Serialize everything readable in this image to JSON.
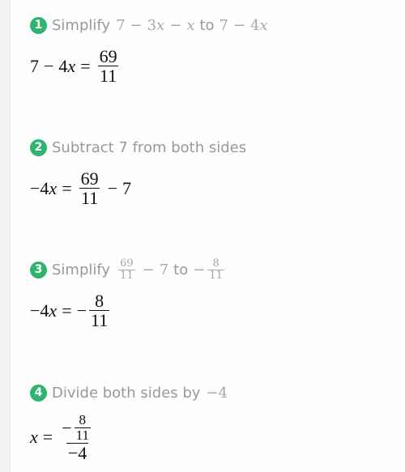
{
  "colors": {
    "badge": "#2fb46e",
    "step_text": "#999999",
    "math": "#111111"
  },
  "steps": [
    {
      "number": "1",
      "action": "Simplify",
      "from": {
        "parts": [
          "7",
          "−",
          "3",
          "x",
          "−",
          "x"
        ]
      },
      "connector": "to",
      "to": {
        "parts": [
          "7",
          "−",
          "4",
          "x"
        ]
      },
      "equation": {
        "lhs": [
          "7",
          "−",
          "4",
          "x"
        ],
        "eq": "=",
        "rhs_num": "69",
        "rhs_den": "11"
      }
    },
    {
      "number": "2",
      "action": "Subtract 7 from both sides",
      "equation": {
        "lhs": [
          "−",
          "4",
          "x"
        ],
        "eq": "=",
        "rhs_num": "69",
        "rhs_den": "11",
        "rhs_tail": [
          "−",
          "7"
        ]
      }
    },
    {
      "number": "3",
      "action": "Simplify",
      "from": {
        "frac_num": "69",
        "frac_den": "11",
        "tail": [
          "−",
          "7"
        ]
      },
      "connector": "to",
      "to": {
        "sign": "−",
        "frac_num": "8",
        "frac_den": "11"
      },
      "equation": {
        "lhs": [
          "−",
          "4",
          "x"
        ],
        "eq": "=",
        "rhs_sign": "−",
        "rhs_num": "8",
        "rhs_den": "11"
      }
    },
    {
      "number": "4",
      "action": "Divide both sides by",
      "action_value": "−4",
      "equation": {
        "lhs": "x",
        "eq": "=",
        "num_sign": "−",
        "num_num": "8",
        "num_den": "11",
        "den": "−4"
      }
    }
  ]
}
